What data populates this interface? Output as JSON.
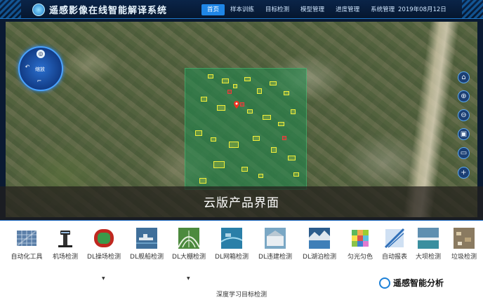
{
  "app": {
    "title": "遥感影像在线智能解译系统",
    "date": "2019年08月12日"
  },
  "nav": [
    {
      "label": "首页",
      "active": true
    },
    {
      "label": "样本训练"
    },
    {
      "label": "目标检测"
    },
    {
      "label": "模型管理"
    },
    {
      "label": "进度管理"
    },
    {
      "label": "系统管理"
    }
  ],
  "compass": {
    "label": "缩放"
  },
  "map": {
    "caption": "云版产品界面"
  },
  "map_tools": [
    {
      "icon": "home-icon"
    },
    {
      "icon": "zoom-in-icon"
    },
    {
      "icon": "zoom-out-icon"
    },
    {
      "icon": "image-icon"
    },
    {
      "icon": "keyboard-icon"
    },
    {
      "icon": "plus-icon"
    }
  ],
  "toolbar": {
    "group_label": "深度学习目标检测",
    "items": [
      {
        "label": "自动化工具",
        "icon": "solar-panel-icon"
      },
      {
        "label": "机场检测",
        "icon": "airport-tower-icon"
      },
      {
        "label": "DL操场检测",
        "icon": "playground-icon",
        "has_dropdown": true
      },
      {
        "label": "DL舰船检测",
        "icon": "ship-icon"
      },
      {
        "label": "DL大棚检测",
        "icon": "greenhouse-icon",
        "has_dropdown": true
      },
      {
        "label": "DL网箱检测",
        "icon": "net-cage-icon"
      },
      {
        "label": "DL违建检测",
        "icon": "illegal-building-icon"
      },
      {
        "label": "DL湖泊检测",
        "icon": "lake-icon"
      },
      {
        "label": "匀光匀色",
        "icon": "color-balance-icon"
      },
      {
        "label": "自动报表",
        "icon": "report-icon"
      },
      {
        "label": "大坝检测",
        "icon": "dam-icon"
      },
      {
        "label": "垃圾检测",
        "icon": "garbage-icon"
      }
    ]
  },
  "watermark": {
    "text": "遥感智能分析"
  }
}
